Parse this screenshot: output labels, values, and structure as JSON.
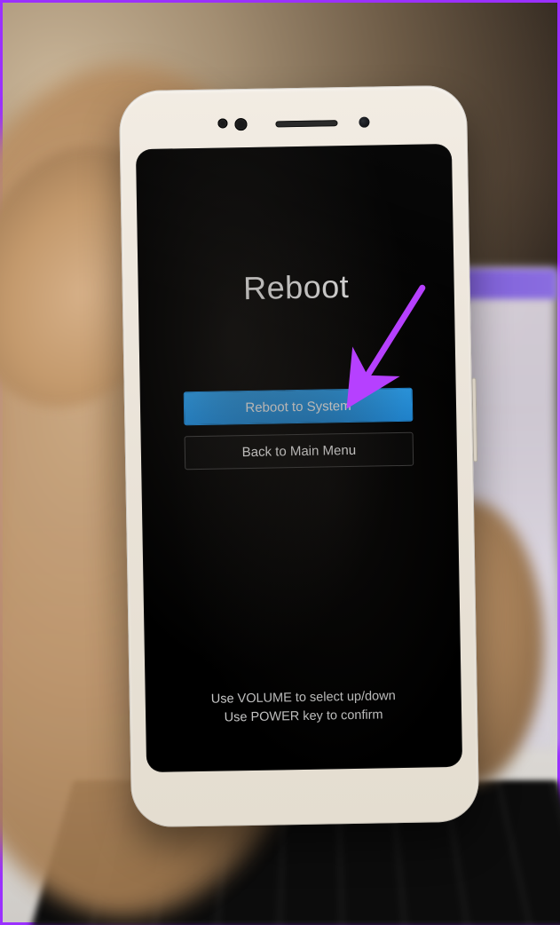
{
  "recovery": {
    "title": "Reboot",
    "options": [
      {
        "label": "Reboot to System",
        "selected": true
      },
      {
        "label": "Back to Main Menu",
        "selected": false
      }
    ],
    "hint_line1": "Use VOLUME to select up/down",
    "hint_line2": "Use POWER key to confirm"
  },
  "annotation": {
    "arrow_color": "#b640ff",
    "frame_border_color": "#9b30ff"
  }
}
